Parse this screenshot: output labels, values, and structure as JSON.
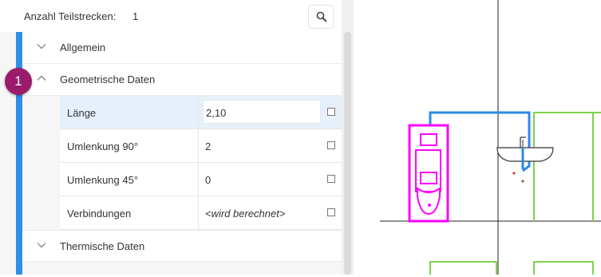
{
  "header": {
    "label": "Anzahl Teilstrecken:",
    "count": "1"
  },
  "groups": {
    "allgemein": "Allgemein",
    "geometrisch": "Geometrische Daten",
    "thermisch": "Thermische Daten"
  },
  "badge": "1",
  "rows": [
    {
      "name": "Länge",
      "value": "2,10"
    },
    {
      "name": "Umlenkung 90°",
      "value": "2"
    },
    {
      "name": "Umlenkung 45°",
      "value": "0"
    },
    {
      "name": "Verbindungen",
      "value": "<wird berechnet>"
    }
  ],
  "colors": {
    "accent_blue": "#2f8fe6",
    "badge": "#9b1b6c",
    "pipe_blue": "#2b8ae6",
    "fixture_magenta": "#ff00ff",
    "wall_green": "#7fd24a"
  }
}
